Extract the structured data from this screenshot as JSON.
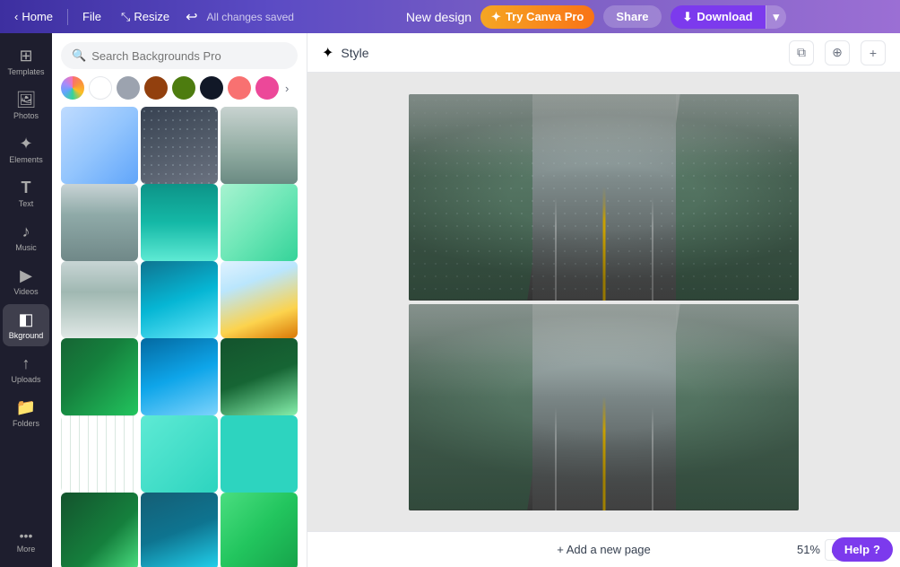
{
  "topbar": {
    "home_label": "Home",
    "file_label": "File",
    "resize_label": "Resize",
    "undo_symbol": "↩",
    "autosave_text": "All changes saved",
    "new_design_label": "New design",
    "try_pro_label": "Try Canva Pro",
    "share_label": "Share",
    "download_label": "Download",
    "pro_icon": "✦"
  },
  "nav": {
    "items": [
      {
        "id": "templates",
        "icon": "⊞",
        "label": "Templates"
      },
      {
        "id": "photos",
        "icon": "🖼",
        "label": "Photos"
      },
      {
        "id": "elements",
        "icon": "✦",
        "label": "Elements"
      },
      {
        "id": "text",
        "icon": "T",
        "label": "Text"
      },
      {
        "id": "music",
        "icon": "♪",
        "label": "Music"
      },
      {
        "id": "videos",
        "icon": "▶",
        "label": "Videos"
      },
      {
        "id": "bkground",
        "icon": "◧",
        "label": "Bkground"
      },
      {
        "id": "uploads",
        "icon": "↑",
        "label": "Uploads"
      },
      {
        "id": "folders",
        "icon": "📁",
        "label": "Folders"
      },
      {
        "id": "more",
        "icon": "···",
        "label": "More"
      }
    ],
    "active_item": "bkground"
  },
  "panel": {
    "search_placeholder": "Search Backgrounds Pro",
    "swatches": [
      {
        "color": "multicolor",
        "type": "multi"
      },
      {
        "color": "#ffffff",
        "type": "solid"
      },
      {
        "color": "#9ca3af",
        "type": "solid"
      },
      {
        "color": "#92400e",
        "type": "solid"
      },
      {
        "color": "#4d7c0f",
        "type": "solid"
      },
      {
        "color": "#111827",
        "type": "solid"
      },
      {
        "color": "#f87171",
        "type": "solid"
      },
      {
        "color": "#ec4899",
        "type": "solid"
      }
    ],
    "more_swatches": "›"
  },
  "style_bar": {
    "label": "Style",
    "star_icon": "✦",
    "page_icon": "⧉",
    "copy_icon": "⊕",
    "add_icon": "+"
  },
  "canvas": {
    "pages": 2
  },
  "bottom_bar": {
    "add_page_label": "+ Add a new page",
    "zoom_level": "51%",
    "help_label": "Help",
    "question_mark": "?"
  }
}
